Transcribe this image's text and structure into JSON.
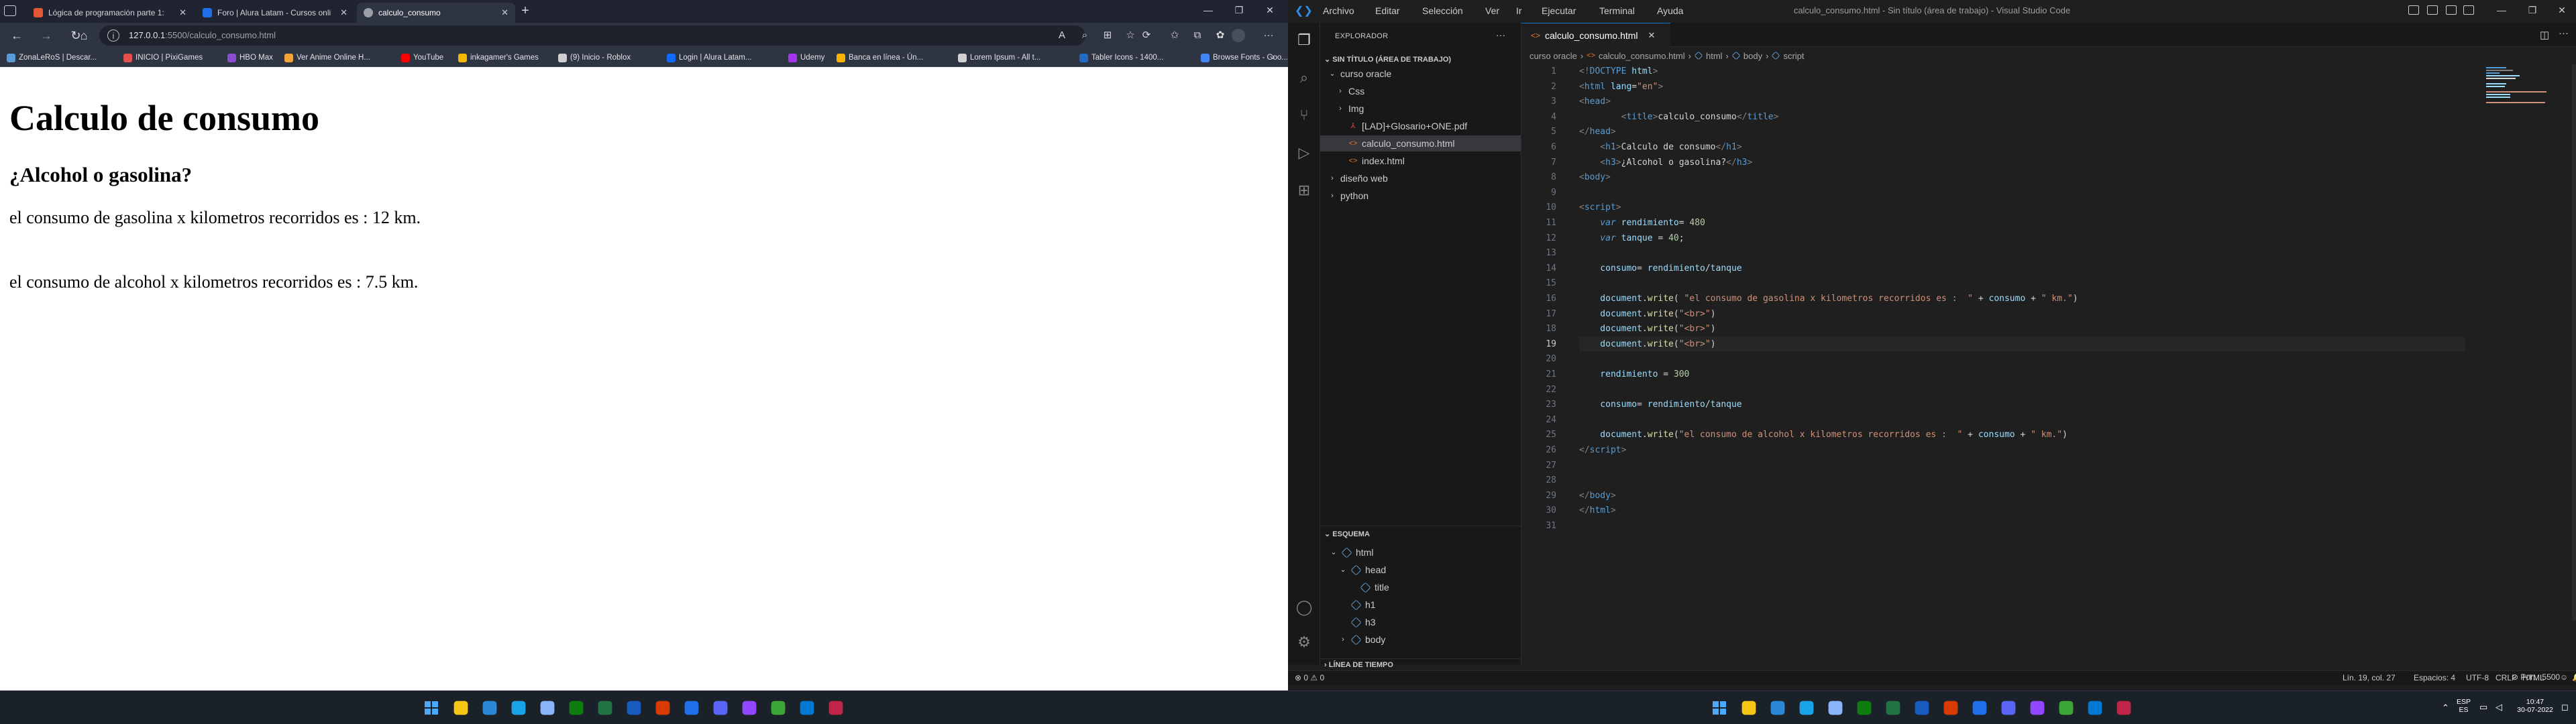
{
  "browser": {
    "tabs": [
      {
        "title": "Lógica de programación parte 1:",
        "color": "#e45735"
      },
      {
        "title": "Foro | Alura Latam - Cursos onli",
        "color": "#1f6feb"
      },
      {
        "title": "calculo_consumo",
        "color": "#9aa0a6"
      }
    ],
    "new_tab_label": "+",
    "address": {
      "host": "127.0.0.1",
      "path": ":5500/calculo_consumo.html"
    },
    "bookmarks": [
      {
        "label": "ZonaLeRoS | Descar...",
        "color": "#5b9bd5"
      },
      {
        "label": "INICIO | PixiGames",
        "color": "#e34f4f"
      },
      {
        "label": "HBO Max",
        "color": "#8a4dd0"
      },
      {
        "label": "Ver Anime Online H...",
        "color": "#f2a33a"
      },
      {
        "label": "YouTube",
        "color": "#ff0000"
      },
      {
        "label": "inkagamer's Games",
        "color": "#f5b800"
      },
      {
        "label": "(9) Inicio - Roblox",
        "color": "#cfcfcf"
      },
      {
        "label": "Login | Alura Latam...",
        "color": "#0f6bff"
      },
      {
        "label": "Udemy",
        "color": "#a435f0"
      },
      {
        "label": "Banca en línea - Ún...",
        "color": "#f9b100"
      },
      {
        "label": "Lorem Ipsum - All t...",
        "color": "#d0d0d0"
      },
      {
        "label": "Tabler Icons - 1400...",
        "color": "#206bc4"
      },
      {
        "label": "Browse Fonts - Goo...",
        "color": "#4285f4"
      }
    ],
    "page": {
      "h1": "Calculo de consumo",
      "h3": "¿Alcohol o gasolina?",
      "line1": "el consumo de gasolina x kilometros recorridos es : 12 km.",
      "line2": "el consumo de alcohol x kilometros recorridos es : 7.5 km."
    }
  },
  "vscode": {
    "menu": [
      "Archivo",
      "Editar",
      "Selección",
      "Ver",
      "Ir",
      "Ejecutar",
      "Terminal",
      "Ayuda"
    ],
    "window_title": "calculo_consumo.html - Sin título (área de trabajo) - Visual Studio Code",
    "explorer": {
      "title": "EXPLORADOR",
      "workspace": "SIN TÍTULO (ÁREA DE TRABAJO)",
      "items": [
        {
          "label": "curso oracle",
          "depth": 1,
          "kind": "folder-open"
        },
        {
          "label": "Css",
          "depth": 2,
          "kind": "folder"
        },
        {
          "label": "Img",
          "depth": 2,
          "kind": "folder"
        },
        {
          "label": "[LAD]+Glosario+ONE.pdf",
          "depth": 2,
          "kind": "pdf"
        },
        {
          "label": "calculo_consumo.html",
          "depth": 2,
          "kind": "html",
          "selected": true
        },
        {
          "label": "index.html",
          "depth": 2,
          "kind": "html"
        },
        {
          "label": "diseño web",
          "depth": 1,
          "kind": "folder"
        },
        {
          "label": "python",
          "depth": 1,
          "kind": "folder"
        }
      ],
      "outline_title": "ESQUEMA",
      "outline": [
        {
          "label": "html",
          "depth": 1,
          "open": true
        },
        {
          "label": "head",
          "depth": 2,
          "open": true
        },
        {
          "label": "title",
          "depth": 3
        },
        {
          "label": "h1",
          "depth": 2
        },
        {
          "label": "h3",
          "depth": 2
        },
        {
          "label": "body",
          "depth": 2,
          "open": false
        }
      ],
      "timeline_title": "LÍNEA DE TIEMPO"
    },
    "editor_tab": "calculo_consumo.html",
    "breadcrumb": [
      "curso oracle",
      "calculo_consumo.html",
      "html",
      "body",
      "script"
    ],
    "current_line": 19,
    "code_lines": [
      [
        [
          "<!",
          "p"
        ],
        [
          "DOCTYPE",
          "t"
        ],
        [
          " html",
          "a"
        ],
        [
          ">",
          "p"
        ]
      ],
      [
        [
          "<",
          "p"
        ],
        [
          "html",
          "t"
        ],
        [
          " lang",
          "a"
        ],
        [
          "=",
          "w"
        ],
        [
          "\"en\"",
          "s"
        ],
        [
          ">",
          "p"
        ]
      ],
      [
        [
          "<",
          "p"
        ],
        [
          "head",
          "t"
        ],
        [
          ">",
          "p"
        ]
      ],
      [
        [
          "        <",
          "p"
        ],
        [
          "title",
          "t"
        ],
        [
          ">",
          "p"
        ],
        [
          "calculo_consumo",
          "w"
        ],
        [
          "</",
          "p"
        ],
        [
          "title",
          "t"
        ],
        [
          ">",
          "p"
        ]
      ],
      [
        [
          "</",
          "p"
        ],
        [
          "head",
          "t"
        ],
        [
          ">",
          "p"
        ]
      ],
      [
        [
          "    <",
          "p"
        ],
        [
          "h1",
          "t"
        ],
        [
          ">",
          "p"
        ],
        [
          "Calculo de consumo",
          "w"
        ],
        [
          "</",
          "p"
        ],
        [
          "h1",
          "t"
        ],
        [
          ">",
          "p"
        ]
      ],
      [
        [
          "    <",
          "p"
        ],
        [
          "h3",
          "t"
        ],
        [
          ">",
          "p"
        ],
        [
          "¿Alcohol o gasolina?",
          "w"
        ],
        [
          "</",
          "p"
        ],
        [
          "h3",
          "t"
        ],
        [
          ">",
          "p"
        ]
      ],
      [
        [
          "<",
          "p"
        ],
        [
          "body",
          "t"
        ],
        [
          ">",
          "p"
        ]
      ],
      [],
      [
        [
          "<",
          "p"
        ],
        [
          "script",
          "t"
        ],
        [
          ">",
          "p"
        ]
      ],
      [
        [
          "    var",
          "k"
        ],
        [
          " rendimiento",
          "v"
        ],
        [
          "= ",
          "o"
        ],
        [
          "480",
          "n"
        ]
      ],
      [
        [
          "    var",
          "k"
        ],
        [
          " tanque",
          "v"
        ],
        [
          " = ",
          "o"
        ],
        [
          "40",
          "n"
        ],
        [
          ";",
          "w"
        ]
      ],
      [],
      [
        [
          "    consumo",
          "v"
        ],
        [
          "= ",
          "o"
        ],
        [
          "rendimiento",
          "v"
        ],
        [
          "/",
          "o"
        ],
        [
          "tanque",
          "v"
        ]
      ],
      [],
      [
        [
          "    document",
          "v"
        ],
        [
          ".",
          "w"
        ],
        [
          "write",
          "f"
        ],
        [
          "( ",
          "w"
        ],
        [
          "\"el consumo de gasolina x kilometros recorridos es :  \"",
          "s"
        ],
        [
          " + ",
          "o"
        ],
        [
          "consumo",
          "v"
        ],
        [
          " + ",
          "o"
        ],
        [
          "\" km.\"",
          "s"
        ],
        [
          ")",
          "w"
        ]
      ],
      [
        [
          "    document",
          "v"
        ],
        [
          ".",
          "w"
        ],
        [
          "write",
          "f"
        ],
        [
          "(",
          "w"
        ],
        [
          "\"<br>\"",
          "s"
        ],
        [
          ")",
          "w"
        ]
      ],
      [
        [
          "    document",
          "v"
        ],
        [
          ".",
          "w"
        ],
        [
          "write",
          "f"
        ],
        [
          "(",
          "w"
        ],
        [
          "\"<br>\"",
          "s"
        ],
        [
          ")",
          "w"
        ]
      ],
      [
        [
          "    document",
          "v"
        ],
        [
          ".",
          "w"
        ],
        [
          "write",
          "f"
        ],
        [
          "(",
          "w"
        ],
        [
          "\"<br>\"",
          "s"
        ],
        [
          ")",
          "w"
        ]
      ],
      [],
      [
        [
          "    rendimiento",
          "v"
        ],
        [
          " = ",
          "o"
        ],
        [
          "300",
          "n"
        ]
      ],
      [],
      [
        [
          "    consumo",
          "v"
        ],
        [
          "= ",
          "o"
        ],
        [
          "rendimiento",
          "v"
        ],
        [
          "/",
          "o"
        ],
        [
          "tanque",
          "v"
        ]
      ],
      [],
      [
        [
          "    document",
          "v"
        ],
        [
          ".",
          "w"
        ],
        [
          "write",
          "f"
        ],
        [
          "(",
          "w"
        ],
        [
          "\"el consumo de alcohol x kilometros recorridos es :  \"",
          "s"
        ],
        [
          " + ",
          "o"
        ],
        [
          "consumo",
          "v"
        ],
        [
          " + ",
          "o"
        ],
        [
          "\" km.\"",
          "s"
        ],
        [
          ")",
          "w"
        ]
      ],
      [
        [
          "</",
          "p"
        ],
        [
          "script",
          "t"
        ],
        [
          ">",
          "p"
        ]
      ],
      [],
      [],
      [
        [
          "</",
          "p"
        ],
        [
          "body",
          "t"
        ],
        [
          ">",
          "p"
        ]
      ],
      [
        [
          "</",
          "p"
        ],
        [
          "html",
          "t"
        ],
        [
          ">",
          "p"
        ]
      ],
      []
    ],
    "token_colors": {
      "p": "#808080",
      "t": "#569cd6",
      "a": "#9cdcfe",
      "s": "#ce9178",
      "k": "#569cd6",
      "v": "#9cdcfe",
      "n": "#b5cea8",
      "o": "#d4d4d4",
      "f": "#dcdcaa",
      "w": "#d4d4d4"
    },
    "status": {
      "problems": "0",
      "warnings": "0",
      "position": "Lín. 19, col. 27",
      "spaces": "Espacios: 4",
      "encoding": "UTF-8",
      "eol": "CRLF",
      "language": "HTML",
      "port": "Port : 5500"
    }
  },
  "taskbar": {
    "apps_left": [
      "#f5c518",
      "#2b88d8",
      "#1aa3e8",
      "#8ab4f8",
      "#107c10",
      "#217346",
      "#185abd",
      "#d83b01",
      "#1f6feb",
      "#5865f2",
      "#9146ff",
      "#3da639",
      "#0078d4",
      "#c0264b"
    ],
    "tray": {
      "lang": "ESP",
      "region": "ES",
      "time": "10:47",
      "date": "30-07-2022"
    }
  }
}
